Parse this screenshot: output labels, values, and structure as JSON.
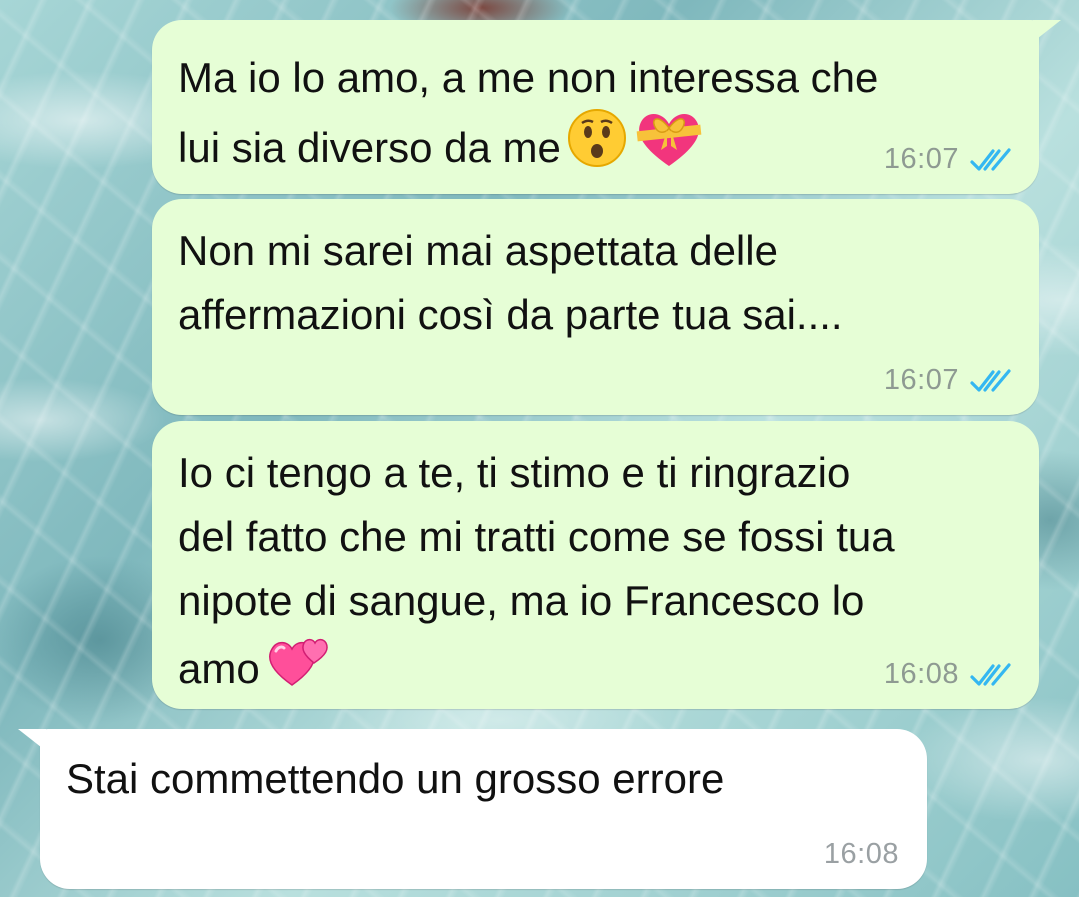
{
  "colors": {
    "outgoing_bubble": "#e6fed6",
    "incoming_bubble": "#ffffff",
    "read_ticks": "#34b7f1",
    "time_text": "#8e9a92"
  },
  "messages": [
    {
      "direction": "outgoing",
      "text": "Ma io lo amo, a me non interessa che\nlui sia diverso da me",
      "emojis": [
        "astonished-face-emoji",
        "heart-with-ribbon-emoji"
      ],
      "time": "16:07",
      "status": "read"
    },
    {
      "direction": "outgoing",
      "text": "Non mi sarei mai aspettata delle\naffermazioni così da parte tua sai....",
      "emojis": [],
      "time": "16:07",
      "status": "read"
    },
    {
      "direction": "outgoing",
      "text": "Io ci tengo a te, ti stimo e ti ringrazio\ndel fatto che mi tratti come se fossi tua\nnipote di sangue, ma io Francesco lo\namo",
      "emojis": [
        "two-hearts-emoji"
      ],
      "time": "16:08",
      "status": "read"
    },
    {
      "direction": "incoming",
      "text": "Stai commettendo un grosso errore",
      "emojis": [],
      "time": "16:08"
    }
  ]
}
